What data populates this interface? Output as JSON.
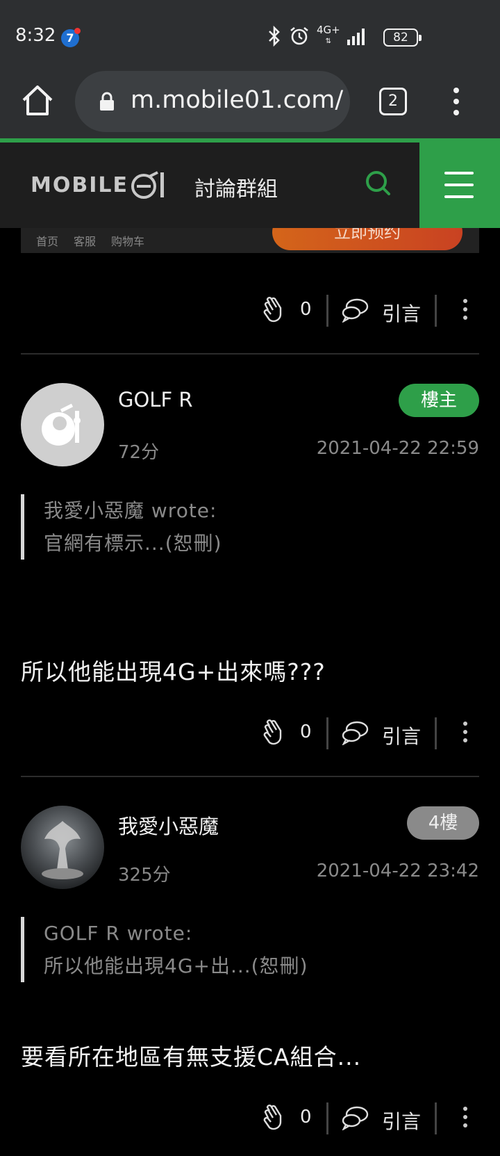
{
  "status_bar": {
    "time": "8:32",
    "network": "4G+",
    "battery": "82"
  },
  "browser": {
    "url": "m.mobile01.com/",
    "tab_count": "2"
  },
  "site": {
    "logo": "MOBILE",
    "section_title": "討論群組"
  },
  "ad": {
    "nav_items": [
      "首页",
      "客服",
      "购物车"
    ],
    "cta": "立即预约"
  },
  "actions": {
    "quote_label": "引言"
  },
  "posts": [
    {
      "likes": "0"
    },
    {
      "username": "GOLF R",
      "badge": "樓主",
      "score": "72分",
      "time": "2021-04-22 22:59",
      "quote_author": "我愛小惡魔 wrote:",
      "quote_text": "官網有標示...(恕刪)",
      "body": "所以他能出現4G+出來嗎???",
      "likes": "0"
    },
    {
      "username": "我愛小惡魔",
      "badge": "4樓",
      "score": "325分",
      "time": "2021-04-22 23:42",
      "quote_author": "GOLF R wrote:",
      "quote_text": "所以他能出現4G+出...(恕刪)",
      "body": "要看所在地區有無支援CA組合...",
      "likes": "0"
    }
  ],
  "colors": {
    "accent_green": "#2e9f49",
    "background": "#000000",
    "header_bg": "#1e1e1e"
  }
}
